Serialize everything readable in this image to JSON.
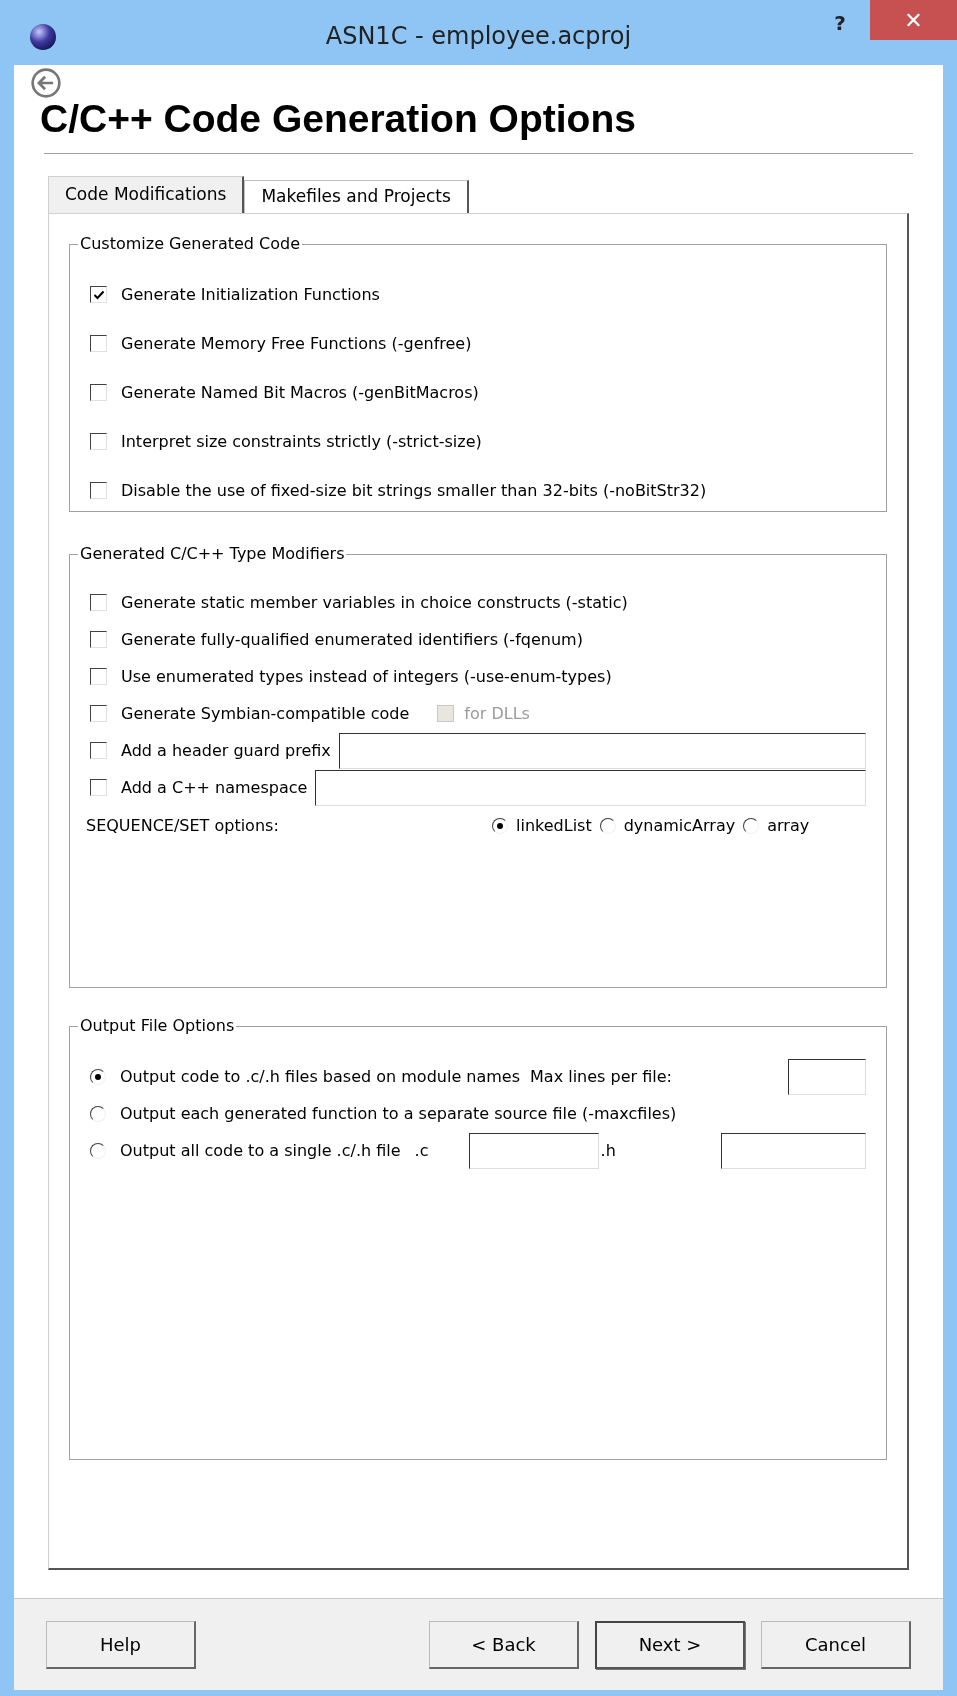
{
  "window": {
    "title": "ASN1C - employee.acproj",
    "help": "?",
    "close": "✕"
  },
  "page": {
    "title": "C/C++ Code Generation Options"
  },
  "tabs": [
    {
      "label": "Code Modifications",
      "selected": true
    },
    {
      "label": "Makefiles and Projects",
      "selected": false
    }
  ],
  "customize_group": {
    "title": "Customize Generated Code",
    "options": [
      {
        "label": "Generate Initialization Functions",
        "checked": true
      },
      {
        "label": "Generate Memory Free Functions (-genfree)",
        "checked": false
      },
      {
        "label": "Generate Named Bit Macros (-genBitMacros)",
        "checked": false
      },
      {
        "label": "Interpret size constraints strictly (-strict-size)",
        "checked": false
      },
      {
        "label": "Disable the use of fixed-size bit strings smaller than 32-bits (-noBitStr32)",
        "checked": false
      }
    ]
  },
  "modifiers_group": {
    "title": "Generated C/C++ Type Modifiers",
    "options": [
      {
        "kind": "checkbox",
        "label": "Generate static member variables in choice constructs (-static)",
        "checked": false
      },
      {
        "kind": "checkbox",
        "label": "Generate fully-qualified enumerated identifiers (-fqenum)",
        "checked": false
      },
      {
        "kind": "checkbox",
        "label": "Use enumerated types instead of integers (-use-enum-types)",
        "checked": false
      },
      {
        "kind": "checkbox_sub",
        "label": "Generate Symbian-compatible code",
        "checked": false,
        "sub": {
          "label": "for DLLs",
          "checked": false,
          "disabled": true
        }
      },
      {
        "kind": "checkbox_field",
        "label": "Add a header guard prefix",
        "checked": false
      },
      {
        "kind": "checkbox_field",
        "label": "Add a C++ namespace",
        "checked": false
      }
    ],
    "sequence_set": {
      "label": "SEQUENCE/SET options:",
      "options": [
        {
          "label": "linkedList",
          "selected": true
        },
        {
          "label": "dynamicArray",
          "selected": false
        },
        {
          "label": "array",
          "selected": false
        }
      ]
    }
  },
  "output_group": {
    "title": "Output File Options",
    "options": [
      {
        "kind": "max_lines",
        "label": "Output code to .c/.h files based on module names",
        "selected": true,
        "fields": [
          {
            "label": "Max lines per file:"
          }
        ]
      },
      {
        "kind": "plain",
        "label": "Output each generated function to a separate source file (-maxcfiles)",
        "selected": false
      },
      {
        "kind": "two_files",
        "label": "Output all code to a single .c/.h file",
        "selected": false,
        "fields": [
          {
            "label": ".c"
          },
          {
            "label": ".h"
          }
        ]
      }
    ]
  },
  "buttons": [
    {
      "label": "Help",
      "default": false
    },
    {
      "label": "< Back",
      "default": false
    },
    {
      "label": "Next >",
      "default": true
    },
    {
      "label": "Cancel",
      "default": false
    }
  ]
}
